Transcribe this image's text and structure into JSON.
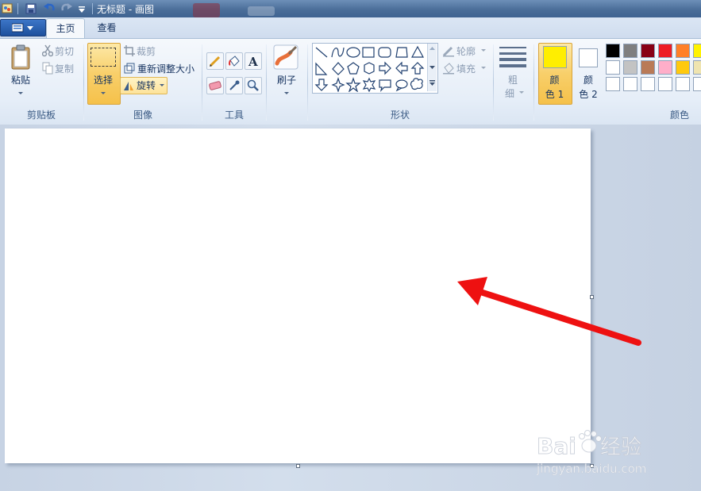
{
  "window": {
    "title": "无标题 - 画图"
  },
  "tabs": [
    {
      "label": "主页"
    },
    {
      "label": "查看"
    }
  ],
  "clipboard": {
    "paste": "粘贴",
    "cut": "剪切",
    "copy": "复制",
    "group": "剪贴板"
  },
  "image": {
    "select": "选择",
    "crop": "裁剪",
    "resize": "重新调整大小",
    "rotate": "旋转",
    "group": "图像"
  },
  "tools": {
    "group": "工具"
  },
  "brushes": {
    "label": "刷子"
  },
  "shapes": {
    "outline": "轮廓",
    "fill": "填充",
    "group": "形状"
  },
  "size": {
    "line1": "粗",
    "line2": "细"
  },
  "colors": {
    "color1_line1": "颜",
    "color1_line2": "色 1",
    "color2_line1": "颜",
    "color2_line2": "色 2",
    "group": "颜色",
    "color1_value": "#ffee00",
    "color2_value": "#ffffff",
    "palette_row1": [
      "#000000",
      "#7f7f7f",
      "#880015",
      "#ed1c24",
      "#ff7f27",
      "#fff200"
    ],
    "palette_row2": [
      "#ffffff",
      "#c3c3c3",
      "#b97a57",
      "#ffaec9",
      "#ffc90e",
      "#efe4b0"
    ],
    "palette_row3": [
      "#ffffff",
      "#ffffff",
      "#ffffff",
      "#ffffff",
      "#ffffff",
      "#ffffff"
    ]
  },
  "annotation": {
    "arrow_color": "#ee1111"
  },
  "watermark": {
    "brand": "Bai 经验",
    "url": "jingyan.baidu.com"
  }
}
